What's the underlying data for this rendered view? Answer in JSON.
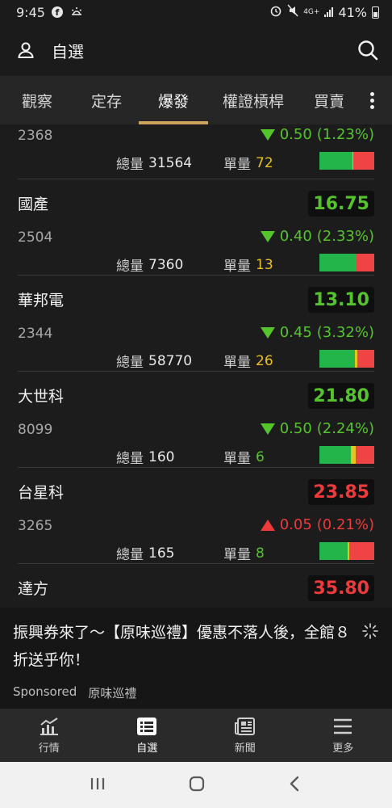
{
  "status_bar": {
    "time": "9:45",
    "network": "4G+",
    "battery": "41%"
  },
  "header": {
    "title": "自選"
  },
  "tabs": [
    {
      "label": "觀察",
      "active": false
    },
    {
      "label": "定存",
      "active": false
    },
    {
      "label": "爆發",
      "active": true
    },
    {
      "label": "權證槓桿",
      "active": false
    },
    {
      "label": "買賣",
      "active": false
    }
  ],
  "labels": {
    "total_volume": "總量",
    "unit_volume": "單量"
  },
  "stocks": [
    {
      "name": "",
      "price": "",
      "code": "2368",
      "change": "0.50",
      "change_pct": "(1.23%)",
      "direction": "down",
      "total_volume": "31564",
      "unit_volume": "72",
      "unit_color": "yellow",
      "bar": {
        "green": 0.6,
        "yellow": 0.02,
        "red": 0.38
      }
    },
    {
      "name": "國產",
      "price": "16.75",
      "code": "2504",
      "change": "0.40",
      "change_pct": "(2.33%)",
      "direction": "down",
      "total_volume": "7360",
      "unit_volume": "13",
      "unit_color": "yellow",
      "bar": {
        "green": 0.68,
        "yellow": 0.0,
        "red": 0.32
      }
    },
    {
      "name": "華邦電",
      "price": "13.10",
      "code": "2344",
      "change": "0.45",
      "change_pct": "(3.32%)",
      "direction": "down",
      "total_volume": "58770",
      "unit_volume": "26",
      "unit_color": "yellow",
      "bar": {
        "green": 0.64,
        "yellow": 0.05,
        "red": 0.31
      }
    },
    {
      "name": "大世科",
      "price": "21.80",
      "code": "8099",
      "change": "0.50",
      "change_pct": "(2.24%)",
      "direction": "down",
      "total_volume": "160",
      "unit_volume": "6",
      "unit_color": "green",
      "bar": {
        "green": 0.58,
        "yellow": 0.08,
        "red": 0.34
      }
    },
    {
      "name": "台星科",
      "price": "23.85",
      "code": "3265",
      "change": "0.05",
      "change_pct": "(0.21%)",
      "direction": "up",
      "total_volume": "165",
      "unit_volume": "8",
      "unit_color": "green",
      "bar": {
        "green": 0.52,
        "yellow": 0.02,
        "red": 0.46
      }
    },
    {
      "name": "達方",
      "price": "35.80",
      "code": "",
      "change": "",
      "change_pct": "",
      "direction": "up",
      "total_volume": "",
      "unit_volume": "",
      "unit_color": "green",
      "bar": {
        "green": 0.5,
        "yellow": 0.0,
        "red": 0.5
      }
    }
  ],
  "ad": {
    "text": "振興券來了～【原味巡禮】優惠不落人後，全館８折送乎你！",
    "sponsored_label": "Sponsored",
    "advertiser": "原味巡禮"
  },
  "bottom_nav": [
    {
      "label": "行情",
      "icon": "chart-icon",
      "active": false
    },
    {
      "label": "自選",
      "icon": "list-icon",
      "active": true
    },
    {
      "label": "新聞",
      "icon": "news-icon",
      "active": false
    },
    {
      "label": "更多",
      "icon": "menu-icon",
      "active": false
    }
  ],
  "colors": {
    "up": "#ee3a3a",
    "down": "#55c42c",
    "accent": "#c9a45a",
    "unit_yellow": "#e8c21a"
  }
}
